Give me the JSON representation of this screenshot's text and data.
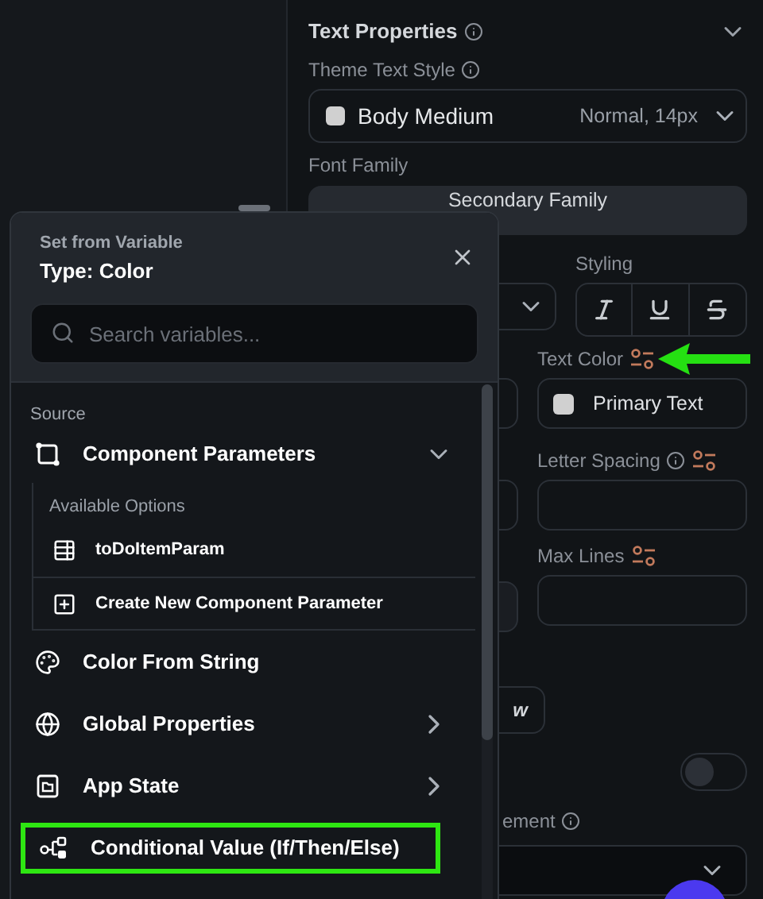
{
  "properties_panel": {
    "title": "Text Properties",
    "collapsed": false,
    "theme_text_style": {
      "label": "Theme Text Style",
      "value": "Body Medium",
      "detail": "Normal, 14px"
    },
    "font_family": {
      "label": "Font Family",
      "value": "Secondary Family"
    },
    "styling": {
      "label": "Styling"
    },
    "text_color": {
      "label": "Text Color",
      "value": "Primary Text"
    },
    "letter_spacing": {
      "label": "Letter Spacing"
    },
    "max_lines": {
      "label": "Max Lines"
    },
    "partial_button": "w",
    "toggle": {
      "on": false
    },
    "partial_label": "ement"
  },
  "variable_popup": {
    "heading": "Set from Variable",
    "type": "Type: Color",
    "search": {
      "placeholder": "Search variables..."
    },
    "section": "Source",
    "items": [
      {
        "kind": "group",
        "label": "Component Parameters",
        "expanded": true,
        "options_title": "Available Options",
        "children": [
          {
            "kind": "param",
            "label": "toDoItemParam"
          },
          {
            "kind": "create",
            "label": "Create New Component Parameter"
          }
        ]
      },
      {
        "kind": "item",
        "label": "Color From String",
        "highlighted": false
      },
      {
        "kind": "submenu",
        "label": "Global Properties",
        "highlighted": false
      },
      {
        "kind": "submenu",
        "label": "App State",
        "highlighted": false
      },
      {
        "kind": "info",
        "label": "Conditional Value (If/Then/Else)",
        "highlighted": true
      }
    ]
  }
}
